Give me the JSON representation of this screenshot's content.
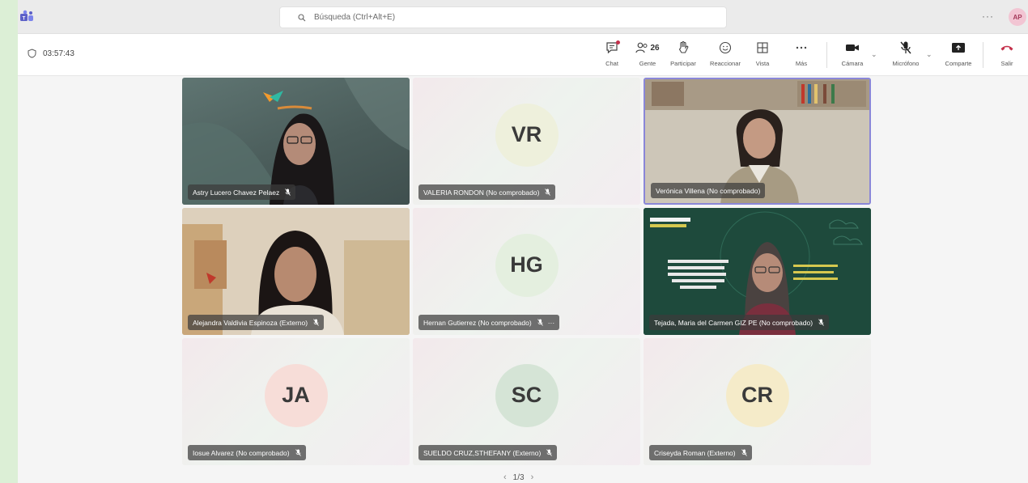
{
  "search": {
    "placeholder": "Búsqueda (Ctrl+Alt+E)"
  },
  "title_bar": {
    "more": "···",
    "avatar_initials": "AP"
  },
  "meeting": {
    "timer": "03:57:43",
    "controls": {
      "chat": "Chat",
      "people": "Gente",
      "people_count": "26",
      "raise": "Participar",
      "react": "Reaccionar",
      "view": "Vista",
      "more": "Más",
      "camera": "Cámara",
      "mic": "Micrófono",
      "share": "Comparte",
      "leave": "Salir"
    }
  },
  "participants": [
    {
      "name": "Astry Lucero Chavez Pelaez",
      "type": "video"
    },
    {
      "name": "VALERIA RONDON (No comprobado)",
      "initials": "VR",
      "type": "avatar",
      "avatar_color": "#eef0dc"
    },
    {
      "name": "Verónica Villena (No comprobado)",
      "type": "video"
    },
    {
      "name": "Alejandra Valdivia Espinoza (Externo)",
      "type": "video"
    },
    {
      "name": "Hernan Gutierrez (No comprobado)",
      "initials": "HG",
      "type": "avatar",
      "avatar_color": "#e4efdf"
    },
    {
      "name": "Tejada, Maria del Carmen GIZ PE (No comprobado)",
      "type": "video"
    },
    {
      "name": "Iosue Alvarez (No comprobado)",
      "initials": "JA",
      "type": "avatar",
      "avatar_color": "#f7ddd8"
    },
    {
      "name": "SUELDO CRUZ,STHEFANY (Externo)",
      "initials": "SC",
      "type": "avatar",
      "avatar_color": "#d5e4d6"
    },
    {
      "name": "Criseyda Roman (Externo)",
      "initials": "CR",
      "type": "avatar",
      "avatar_color": "#f5ebc9"
    }
  ],
  "pager": {
    "label": "1/3"
  },
  "colors": {
    "leave": "#c4314b",
    "accent": "#5b5fc7"
  }
}
